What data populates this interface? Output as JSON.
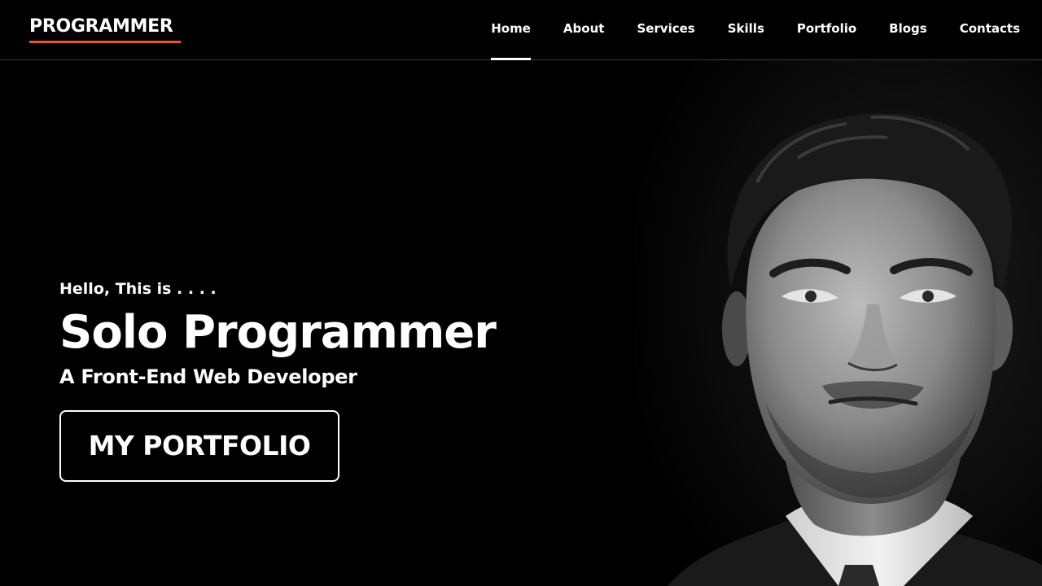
{
  "header": {
    "logo": "PROGRAMMER",
    "logo_accent_color": "#e8572a",
    "nav": [
      {
        "label": "Home",
        "active": true
      },
      {
        "label": "About",
        "active": false
      },
      {
        "label": "Services",
        "active": false
      },
      {
        "label": "Skills",
        "active": false
      },
      {
        "label": "Portfolio",
        "active": false
      },
      {
        "label": "Blogs",
        "active": false
      },
      {
        "label": "Contacts",
        "active": false
      }
    ]
  },
  "hero": {
    "greeting": "Hello, This is . . . .",
    "name": "Solo Programmer",
    "role": "A Front-End Web Developer",
    "cta_label": "MY PORTFOLIO"
  },
  "portrait": {
    "description_icon": "profile-photo"
  }
}
